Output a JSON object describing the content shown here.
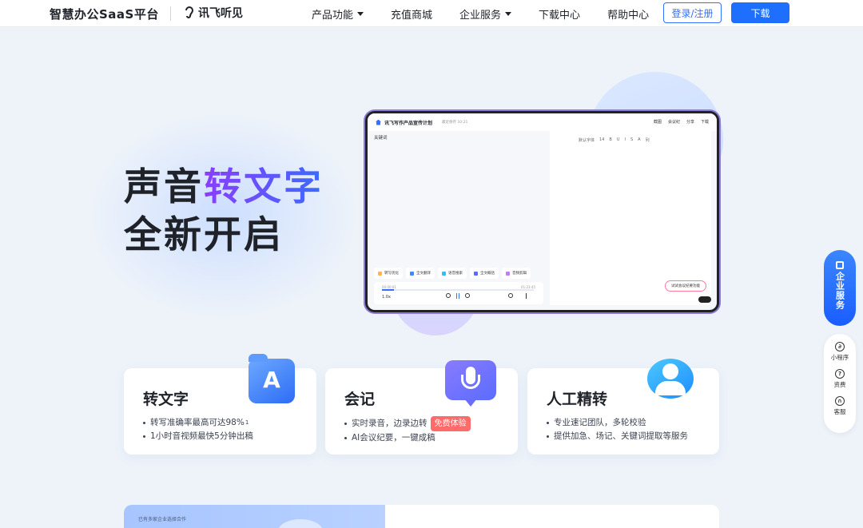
{
  "nav": {
    "brand": "智慧办公SaaS平台",
    "logo_text": "讯飞听见",
    "links": [
      {
        "label": "产品功能",
        "dropdown": true
      },
      {
        "label": "充值商城",
        "dropdown": false
      },
      {
        "label": "企业服务",
        "dropdown": true
      },
      {
        "label": "下载中心",
        "dropdown": false
      },
      {
        "label": "帮助中心",
        "dropdown": false
      }
    ],
    "login_label": "登录/注册",
    "download_label": "下载"
  },
  "hero": {
    "line1_pre": "声音",
    "line1_highlight": "转文字",
    "line2": "全新开启"
  },
  "tablet": {
    "doc_title": "讯飞写作产品宣传计划",
    "doc_meta": "最近保存 10:21",
    "tools": [
      "截图",
      "会议纪",
      "分享",
      "下载"
    ],
    "left_label": "关键词",
    "doc_tools": [
      "默认字体",
      "14",
      "B",
      "U",
      "I",
      "S",
      "A",
      "列"
    ],
    "tabs": [
      "转写优化",
      "全文翻译",
      "语音搜索",
      "全文概括",
      "音频剪辑"
    ],
    "player_speed": "1.0x",
    "player_time_start": "00:00:01",
    "player_time_end": "01:23:45",
    "bubble_text": "试试会议纪要功能"
  },
  "cards": [
    {
      "title": "转文字",
      "items": [
        "转写准确率最高可达98%",
        "1小时音视频最快5分钟出稿"
      ],
      "sup": "1",
      "icon": "translate-a-icon"
    },
    {
      "title": "会记",
      "items": [
        "实时录音，边录边转",
        "AI会议纪要，一键成稿"
      ],
      "badge": "免费体验",
      "icon": "microphone-icon"
    },
    {
      "title": "人工精转",
      "items": [
        "专业速记团队，多轮校验",
        "提供加急、场记、关键词提取等服务"
      ],
      "icon": "person-icon"
    }
  ],
  "float": {
    "enterprise_label": "企业服务",
    "tools": [
      {
        "label": "小程序",
        "icon": "miniprogram-icon"
      },
      {
        "label": "资费",
        "icon": "question-icon"
      },
      {
        "label": "客服",
        "icon": "headset-icon"
      }
    ]
  },
  "bottom": {
    "left_caption": "已有多家企业选择合作"
  },
  "colors": {
    "primary": "#1f6fff",
    "highlight_from": "#8b3dff",
    "highlight_to": "#3a6bff",
    "badge": "#ff6b6b"
  }
}
